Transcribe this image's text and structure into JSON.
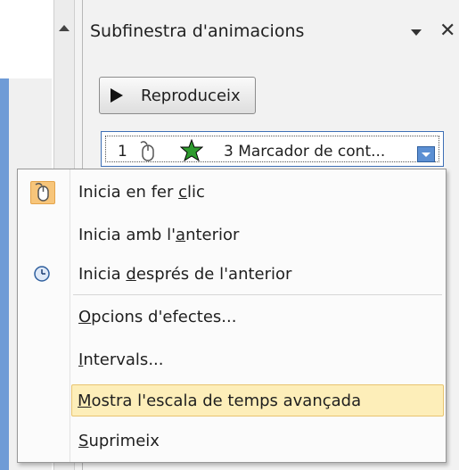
{
  "pane": {
    "title": "Subfinestra d'animacions",
    "play_label": "Reproduceix"
  },
  "animation_item": {
    "number": "1",
    "label": "3 Marcador de cont..."
  },
  "menu": {
    "items": [
      {
        "pre": "Inicia en fer ",
        "key": "c",
        "post": "lic",
        "icon": "mouse-icon",
        "active": true
      },
      {
        "pre": "Inicia amb l'",
        "key": "a",
        "post": "nterior",
        "icon": "",
        "active": false
      },
      {
        "pre": "Inicia ",
        "key": "d",
        "post": "esprés de l'anterior",
        "icon": "clock-icon",
        "active": false
      },
      {
        "pre": "",
        "key": "O",
        "post": "pcions d'efectes...",
        "icon": "",
        "active": false
      },
      {
        "pre": "",
        "key": "I",
        "post": "ntervals...",
        "icon": "",
        "active": false
      },
      {
        "pre": "",
        "key": "M",
        "post": "ostra l'escala de temps avançada",
        "icon": "",
        "active": false,
        "highlighted": true
      },
      {
        "pre": "",
        "key": "S",
        "post": "uprimeix",
        "icon": "",
        "active": false
      }
    ]
  },
  "colors": {
    "highlight": "#fdeeb9",
    "active_icon_bg": "#f7c57a",
    "selection_border": "#3d6eb5"
  }
}
